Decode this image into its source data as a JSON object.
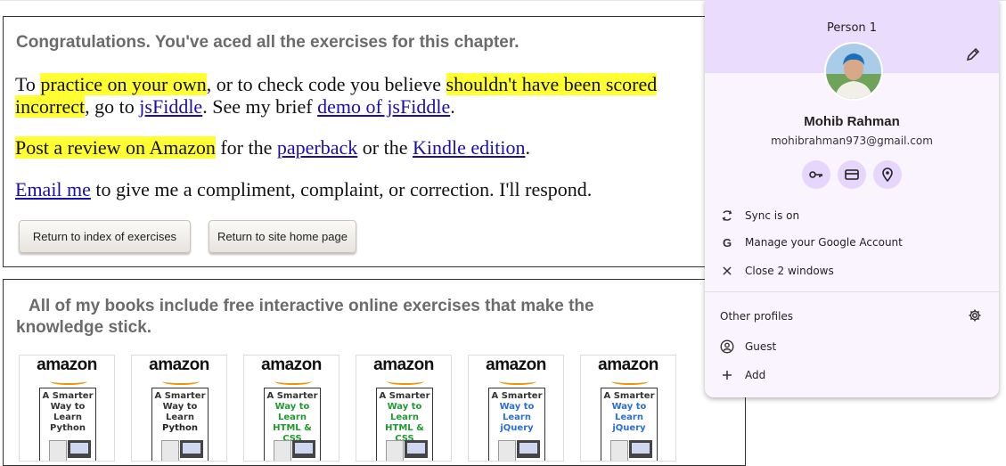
{
  "box1": {
    "heading": "Congratulations. You've aced all the exercises for this chapter.",
    "p1": {
      "t1": "To ",
      "hl1": "practice on your own",
      "t2": ", or to check code you believe ",
      "hl2": "shouldn't have been scored",
      "hl3": "incorrect",
      "t3": ", go to ",
      "link1": "jsFiddle",
      "t4": ". See my brief ",
      "link2": "demo of jsFiddle",
      "t5": "."
    },
    "p2": {
      "hl": "Post a review on Amazon",
      "t1": " for the ",
      "link1": "paperback",
      "t2": " or the ",
      "link2": "Kindle edition",
      "t3": "."
    },
    "p3": {
      "link": "Email me",
      "t1": " to give me a compliment, complaint, or correction. I'll respond."
    },
    "buttons": {
      "index": "Return to index of exercises",
      "home": "Return to site home page"
    }
  },
  "box2": {
    "heading_line1": "All of my books include free interactive online exercises that make the",
    "heading_line2": "knowledge stick.",
    "books": [
      {
        "logo": "amazon",
        "l1": "A Smarter",
        "l2": "Way to",
        "l3": "Learn",
        "l4": "Python",
        "color": "#333333"
      },
      {
        "logo": "amazon",
        "l1": "A Smarter",
        "l2": "Way to",
        "l3": "Learn",
        "l4": "Python",
        "color": "#222222"
      },
      {
        "logo": "amazon",
        "l1": "A Smarter",
        "l2": "Way to",
        "l3": "Learn",
        "l4": "HTML & CSS",
        "color": "#1f9a2e"
      },
      {
        "logo": "amazon",
        "l1": "A Smarter",
        "l2": "Way to",
        "l3": "Learn",
        "l4": "HTML & CSS",
        "color": "#1f9a2e"
      },
      {
        "logo": "amazon",
        "l1": "A Smarter",
        "l2": "Way to",
        "l3": "Learn",
        "l4": "jQuery",
        "color": "#2a6fd6"
      },
      {
        "logo": "amazon",
        "l1": "A Smarter",
        "l2": "Way to",
        "l3": "Learn",
        "l4": "jQuery",
        "color": "#2a6fd6"
      }
    ]
  },
  "profile": {
    "person_label": "Person 1",
    "name": "Mohib Rahman",
    "email": "mohibrahman973@gmail.com",
    "quick_icons": [
      "key-icon",
      "credit-card-icon",
      "location-pin-icon"
    ],
    "menu": [
      {
        "icon": "sync-icon",
        "label": "Sync is on"
      },
      {
        "icon": "google-g-icon",
        "label": "Manage your Google Account"
      },
      {
        "icon": "close-icon",
        "label": "Close 2 windows"
      }
    ],
    "other_profiles_heading": "Other profiles",
    "others": [
      {
        "icon": "guest-icon",
        "label": "Guest"
      },
      {
        "icon": "plus-icon",
        "label": "Add"
      }
    ],
    "colors": {
      "header": "#e9dcfd",
      "panel": "#faf4ff",
      "icon_bg": "#e6d6fb"
    }
  },
  "colors": {
    "highlight": "#ffff33",
    "link": "#1a0dab",
    "heading": "#6b6b6b"
  }
}
